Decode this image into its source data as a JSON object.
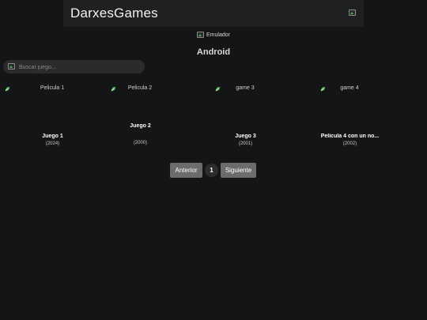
{
  "header": {
    "brand": "DarxesGames"
  },
  "nav": {
    "emulator_label": "Emulador"
  },
  "section": {
    "title": "Android"
  },
  "search": {
    "placeholder": "Buscar juego..."
  },
  "cards": [
    {
      "thumb_alt": "Pelicula 1",
      "title": "Juego 1",
      "year": "(2024)"
    },
    {
      "thumb_alt": "Pelicula 2",
      "title": "Juego 2",
      "year": "(2000)"
    },
    {
      "thumb_alt": "game 3",
      "title": "Juego 3",
      "year": "(2001)"
    },
    {
      "thumb_alt": "game 4",
      "title": "Película 4 con un no...",
      "year": "(2002)"
    }
  ],
  "pagination": {
    "prev_label": "Anterior",
    "current_page": "1",
    "next_label": "Siguiente"
  },
  "colors": {
    "background": "#141516",
    "header": "#1f2021",
    "button": "#6b6c6d"
  }
}
